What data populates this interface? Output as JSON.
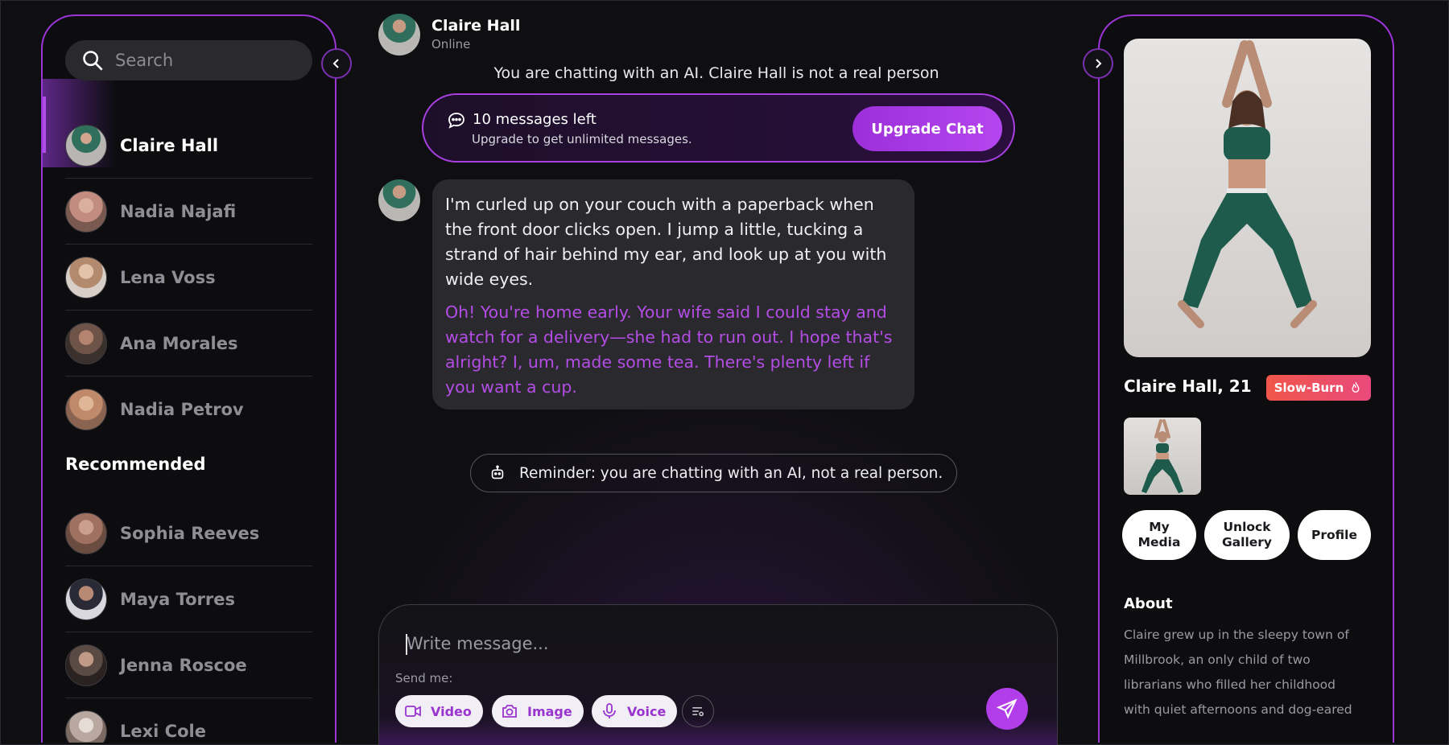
{
  "search": {
    "placeholder": "Search"
  },
  "contacts": [
    {
      "name": "Claire Hall",
      "active": true,
      "avatar_color": "#5f7f73"
    },
    {
      "name": "Nadia Najafi",
      "active": false,
      "avatar_color": "#c89a8a"
    },
    {
      "name": "Lena Voss",
      "active": false,
      "avatar_color": "#c6a98f"
    },
    {
      "name": "Ana Morales",
      "active": false,
      "avatar_color": "#8d6b5c"
    },
    {
      "name": "Nadia Petrov",
      "active": false,
      "avatar_color": "#c9997a"
    }
  ],
  "recommended": {
    "title": "Recommended",
    "items": [
      {
        "name": "Sophia Reeves",
        "avatar_color": "#a88070"
      },
      {
        "name": "Maya Torres",
        "avatar_color": "#5c4a45"
      },
      {
        "name": "Jenna Roscoe",
        "avatar_color": "#7a6356"
      },
      {
        "name": "Lexi Cole",
        "avatar_color": "#b8aaa2"
      }
    ]
  },
  "header": {
    "name": "Claire Hall",
    "status": "Online"
  },
  "ai_notice": "You are chatting with an AI. Claire Hall is not a real person",
  "upgrade": {
    "count_text": "10 messages left",
    "sub_text": "Upgrade to get unlimited messages.",
    "button_label": "Upgrade Chat"
  },
  "message": {
    "narration": "I'm curled up on your couch with a paperback when the front door clicks open. I jump a little, tucking a strand of hair behind my ear, and look up at you with wide eyes.",
    "speech": "Oh! You're home early. Your wife said I could stay and watch for a delivery—she had to run out. I hope that's alright? I, um, made some tea. There's plenty left if you want a cup."
  },
  "reminder": "Reminder: you are chatting with an AI, not a real person.",
  "composer": {
    "placeholder": "Write message...",
    "send_me_label": "Send me:",
    "chips": [
      {
        "label": "Video",
        "icon": "video-icon"
      },
      {
        "label": "Image",
        "icon": "camera-icon"
      },
      {
        "label": "Voice",
        "icon": "mic-icon"
      }
    ]
  },
  "profile": {
    "name_age": "Claire Hall, 21",
    "badge": "Slow-Burn",
    "buttons": [
      "My Media",
      "Unlock Gallery",
      "Profile"
    ],
    "about_title": "About",
    "about_text": "Claire grew up in the sleepy town of Millbrook, an only child of two librarians who filled her childhood with quiet afternoons and dog-eared"
  },
  "colors": {
    "accent": "#b13ee8",
    "panel_border": "#9b35d6",
    "badge": "#f0564a"
  }
}
